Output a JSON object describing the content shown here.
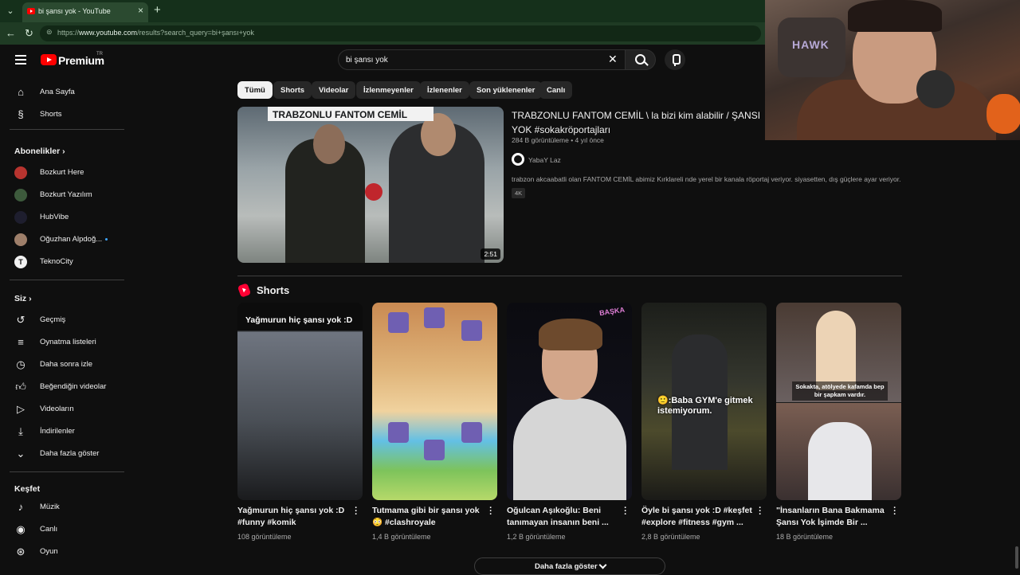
{
  "browser": {
    "tab_title": "bi şansı yok - YouTube",
    "tab_close": "×",
    "new_tab": "+",
    "tab_menu": "⌄",
    "back": "←",
    "reload": "↻",
    "lock": "⊜",
    "url_prefix": "https://",
    "url_domain": "www.youtube.com",
    "url_path": "/results?search_query=bi+şansı+yok"
  },
  "header": {
    "brand": "Premium",
    "region": "TR",
    "search_query": "bi şansı yok",
    "clear": "✕"
  },
  "sidebar": {
    "home": "Ana Sayfa",
    "shorts": "Shorts",
    "subscriptions_heading": "Abonelikler",
    "subscriptions": [
      {
        "name": "Bozkurt Here",
        "color": "#b7342f"
      },
      {
        "name": "Bozkurt Yazılım",
        "color": "#3d5a3c"
      },
      {
        "name": "HubVibe",
        "color": "#1e1e2e"
      },
      {
        "name": "Oğuzhan Alpdoğ...",
        "color": "#9e7f6a"
      },
      {
        "name": "TeknoCity",
        "color": "#f1f1f1"
      }
    ],
    "you_heading": "Siz",
    "you_items": [
      "Geçmiş",
      "Oynatma listeleri",
      "Daha sonra izle",
      "Beğendiğin videolar",
      "Videoların",
      "İndirilenler",
      "Daha fazla göster"
    ],
    "explore_heading": "Keşfet",
    "explore_items": [
      "Müzik",
      "Canlı",
      "Oyun"
    ]
  },
  "chips": [
    "Tümü",
    "Shorts",
    "Videolar",
    "İzlenmeyenler",
    "İzlenenler",
    "Son yüklenenler",
    "Canlı"
  ],
  "video": {
    "thumb_banner": "TRABZONLU FANTOM CEMİL",
    "duration": "2:51",
    "title": "TRABZONLU FANTOM CEMİL \\ la bizi kim alabilir / ŞANSI YOK #sokakröportajları",
    "meta": "284 B görüntüleme • 4 yıl önce",
    "channel": "YabaY Laz",
    "description": "trabzon akcaabatli olan FANTOM CEMİL abimiz Kırklareli nde yerel bir kanala röportaj veriyor. siyasetten, dış güçlere ayar veriyor.",
    "badge": "4K"
  },
  "shorts_heading": "Shorts",
  "shorts": [
    {
      "title": "Yağmurun hiç şansı yok :D #funny #komik",
      "views": "108 görüntüleme",
      "caption": "Yağmurun hiç şansı yok :D"
    },
    {
      "title": "Tutmama gibi bir şansı yok 😳 #clashroyale",
      "views": "1,4 B görüntüleme"
    },
    {
      "title": "Oğulcan Aşıkoğlu: Beni tanımayan insanın beni ...",
      "views": "1,2 B görüntüleme",
      "brand": "BAŞKA"
    },
    {
      "title": "Öyle bi şansı yok :D #keşfet #explore #fitness #gym ...",
      "views": "2,8 B görüntüleme",
      "caption": "🙂:Baba GYM'e gitmek istemiyorum."
    },
    {
      "title": "\"İnsanların Bana Bakmama Şansı Yok İşimde Bir ...",
      "views": "18 B görüntüleme",
      "caption": "Sokakta, atölyede kafamda bep bir şapkam vardır."
    }
  ],
  "more_button": "Daha fazla göster",
  "colors": {
    "accent": "#ff0000",
    "chip_active": "#f1f1f1",
    "link": "#3ea6ff"
  }
}
